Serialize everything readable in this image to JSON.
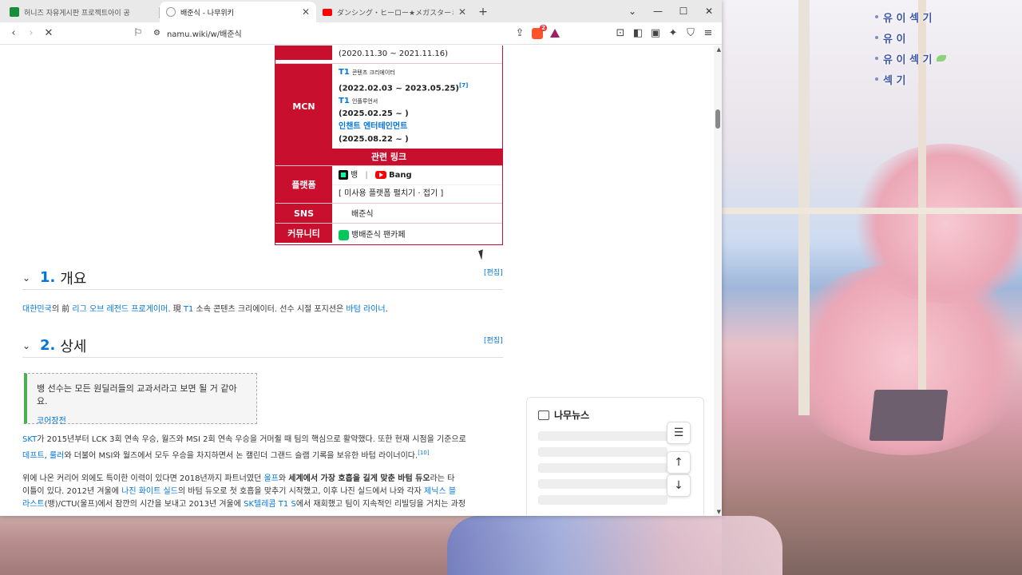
{
  "chat": [
    "유 이 섹 기",
    "유 이",
    "유 이 섹 기",
    "섹 기"
  ],
  "tabs": [
    {
      "title": "허니즈 자유게시판 프로젝트아이 공",
      "color": "#1a8d3a"
    },
    {
      "title": "배준식 - 나무위키",
      "color": "#555555"
    },
    {
      "title": "ダンシング・ヒーロー★メガスターミーDancing",
      "color": "#ff0000"
    }
  ],
  "window_controls": {
    "dropdown": "⌄",
    "min": "—",
    "max": "☐",
    "close": "✕"
  },
  "url": "namu.wiki/w/배준식",
  "brave_badge": "2",
  "infobox": {
    "top_date": "(2020.11.30 ~ 2021.11.16)",
    "mcn_label": "MCN",
    "mcn": [
      {
        "org": "T1",
        "role": "콘텐츠 크리에이터",
        "period": "(2022.02.03 ~ 2023.05.25)",
        "note": "[7]"
      },
      {
        "org": "T1",
        "role": "인플루언서",
        "period": "(2025.02.25 ~ )",
        "note": ""
      },
      {
        "org": "인챈트 엔터테인먼트",
        "role": "",
        "period": "(2025.08.22 ~ )",
        "note": ""
      }
    ],
    "related_title": "관련 링크",
    "platform_label": "플랫폼",
    "platform_chzzk": "뱅",
    "platform_sep": "|",
    "platform_youtube": "Bang",
    "platform_expand": "[ 미사용 플랫폼 펼치기 · 접기 ]",
    "sns_label": "SNS",
    "sns_value": "배준식",
    "community_label": "커뮤니티",
    "community_value": "뱅배준식 팬카페"
  },
  "sections": [
    {
      "num": "1.",
      "title": "개요",
      "edit": "[편집]"
    },
    {
      "num": "2.",
      "title": "상세",
      "edit": "[편집]"
    }
  ],
  "overview": {
    "p1": "대한민국",
    "p2": "의 前 ",
    "p3": "리그 오브 레전드 프로게이머",
    "p4": ". 現 ",
    "p5": "T1",
    "p6": " 소속 콘텐츠 크리에이터. 선수 시절 포지션은 ",
    "p7": "바텀 라이너",
    "p8": "."
  },
  "quote": {
    "text": "뱅 선수는 모든 원딜러들의 교과서라고 보면 될 거 같아요.",
    "source": "코어장전"
  },
  "detail1": {
    "a": "SKT",
    "b": "가 2015년부터 LCK 3회 연속 우승, 월즈와 MSI 2회 연속 우승을 거머쥘 때 팀의 핵심으로 활약했다. 또한 현재 시점을 기준으로",
    "c": "데프트",
    "d": ", ",
    "e": "룰러",
    "f": "와 더불어 MSI와 월즈에서 모두 우승을 차지하면서 논 캘린더 그랜드 슬램 기록을 보유한 바텀 라이너이다.",
    "note": "[10]"
  },
  "detail2": {
    "a": "위에 나온 커리어 외에도 특이한 이력이 있다면 2018년까지 파트너였던 ",
    "b": "울프",
    "c": "와 ",
    "d": "세계에서 가장 호흡을 길게 맞춘 바텀 듀오",
    "e": "라는 타",
    "f": "이틀이 있다. 2012년 겨울에 ",
    "g": "나진 화이트 실드",
    "h": "의 바텀 듀오로 첫 호흡을 맞추기 시작했고, 이후 나진 실드에서 나와 각자 ",
    "i": "제닉스 블",
    "j": "라스트",
    "k": "(뱅)/CTU(울프)에서 잠깐의 시간을 보내고 2013년 겨울에 ",
    "l": "SK텔레콤 T1 S",
    "m": "에서 재회했고 팀이 지속적인 리빌딩을 거치는 과정"
  },
  "news": {
    "title": "나무뉴스"
  },
  "fab": {
    "toc": "☰",
    "up": "↑",
    "down": "↓"
  }
}
